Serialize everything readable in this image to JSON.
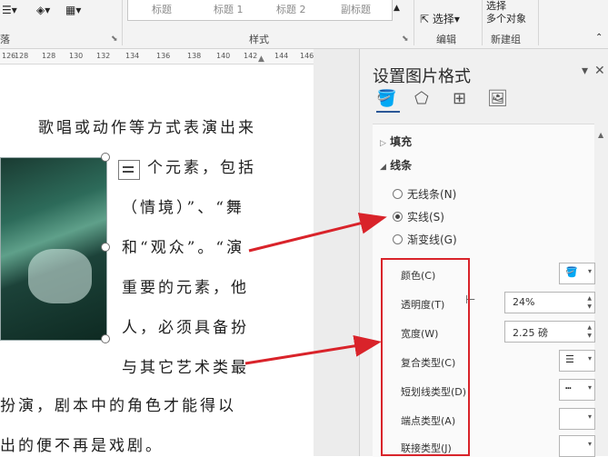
{
  "ribbon": {
    "styles_gallery": [
      "标题",
      "标题 1",
      "标题 2",
      "副标题"
    ],
    "group_styles": "样式",
    "group_edit": "编辑",
    "group_select": "新建组",
    "select_label": "选择",
    "select_multiple": "选择\n多个对象",
    "left_group_fragment": "落"
  },
  "ruler": [
    "128",
    "130",
    "132",
    "134",
    "136",
    "138",
    "140",
    "142",
    "144",
    "146"
  ],
  "ruler_prefix": [
    "126",
    "128"
  ],
  "document": {
    "lines": [
      "歌唱或动作等方式表演出来",
      "个元素，包括",
      "（情境）”、“舞",
      "和“观众”。“演",
      "重要的元素，他",
      "人，必须具备扮",
      "与其它艺术类最",
      "扮演，剧本中的角色才能得以",
      "出的便不再是戏剧。"
    ]
  },
  "pane": {
    "title": "设置图片格式",
    "fill_label": "填充",
    "line_label": "线条",
    "radio_none": "无线条(N)",
    "radio_solid": "实线(S)",
    "radio_gradient": "渐变线(G)",
    "color_label": "颜色(C)",
    "transparency_label": "透明度(T)",
    "transparency_value": "24%",
    "width_label": "宽度(W)",
    "width_value": "2.25 磅",
    "compound_label": "复合类型(C)",
    "dash_label": "短划线类型(D)",
    "cap_label": "端点类型(A)",
    "join_label": "联接类型(J)"
  },
  "colors": {
    "annotation_red": "#d9232a"
  },
  "icons": [
    "fill-line-icon",
    "effects-pentagon-icon",
    "layout-size-icon",
    "picture-icon"
  ]
}
